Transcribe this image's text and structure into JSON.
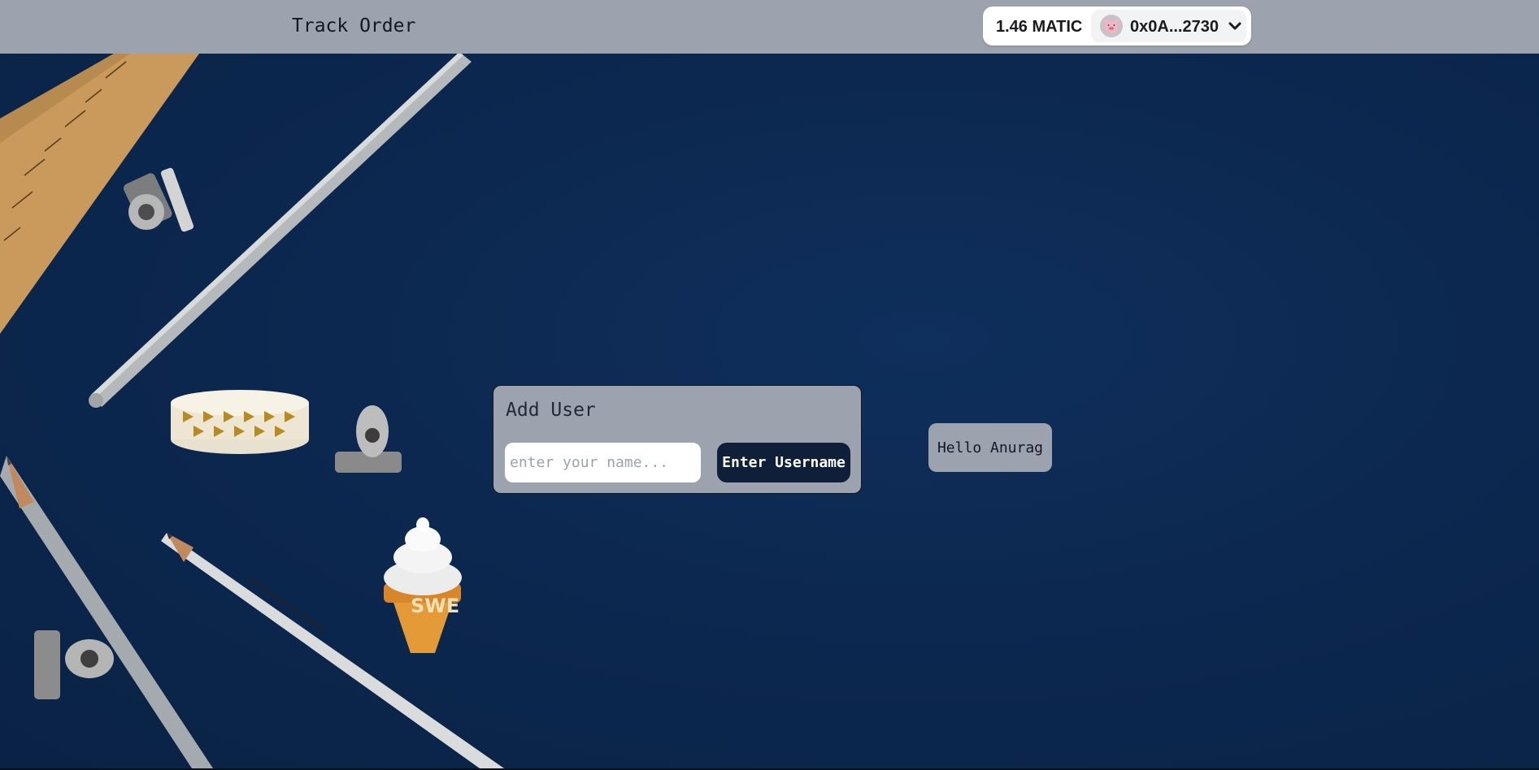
{
  "nav": {
    "track_order": "Track Order"
  },
  "wallet": {
    "balance": "1.46 MATIC",
    "address": "0x0A...2730",
    "avatar_icon": "pig-emoji-avatar",
    "dropdown_icon": "chevron-down-icon"
  },
  "add_user": {
    "title": "Add User",
    "input_placeholder": "enter your name...",
    "input_value": "",
    "button_label": "Enter Username"
  },
  "greeting": {
    "text": "Hello Anurag"
  },
  "colors": {
    "topbar": "#9ca3af",
    "background": "#0c2850",
    "card": "#9ca3af",
    "button": "#0f1f3a"
  }
}
